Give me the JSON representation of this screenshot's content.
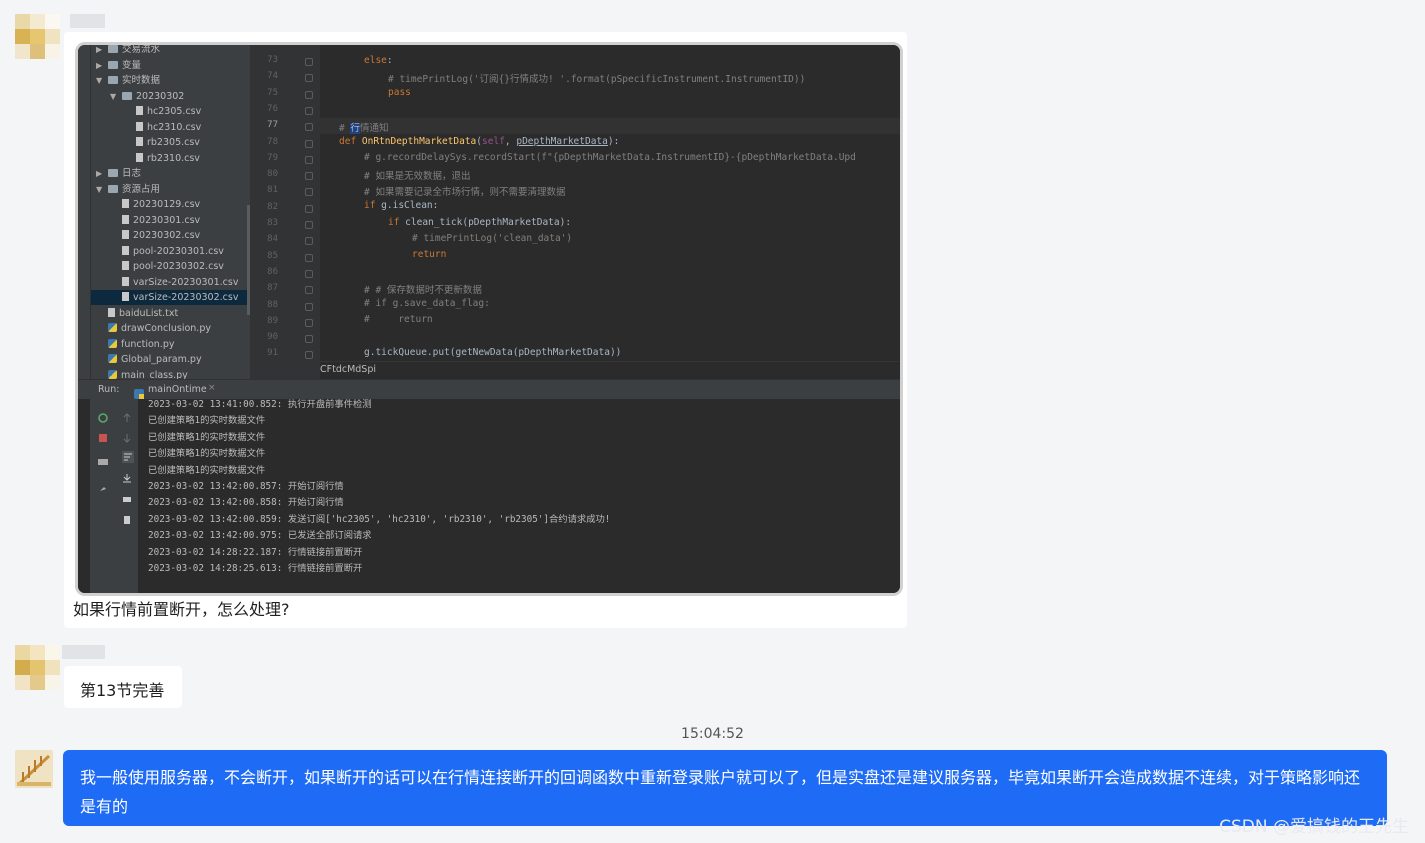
{
  "top_cut_text": "",
  "messages": [
    {
      "sender": "other",
      "caption": "如果行情前置断开，怎么处理?",
      "screenshot": {
        "tree": [
          {
            "label": "交易流水",
            "type": "folder",
            "indent": 1,
            "arrow": "▶"
          },
          {
            "label": "变量",
            "type": "folder",
            "indent": 1,
            "arrow": "▶"
          },
          {
            "label": "实时数据",
            "type": "folder",
            "indent": 1,
            "arrow": "▼"
          },
          {
            "label": "20230302",
            "type": "folder",
            "indent": 2,
            "arrow": "▼"
          },
          {
            "label": "hc2305.csv",
            "type": "file",
            "indent": 3
          },
          {
            "label": "hc2310.csv",
            "type": "file",
            "indent": 3
          },
          {
            "label": "rb2305.csv",
            "type": "file",
            "indent": 3
          },
          {
            "label": "rb2310.csv",
            "type": "file",
            "indent": 3
          },
          {
            "label": "日志",
            "type": "folder",
            "indent": 1,
            "arrow": "▶"
          },
          {
            "label": "资源占用",
            "type": "folder",
            "indent": 1,
            "arrow": "▼"
          },
          {
            "label": "20230129.csv",
            "type": "file",
            "indent": 2
          },
          {
            "label": "20230301.csv",
            "type": "file",
            "indent": 2
          },
          {
            "label": "20230302.csv",
            "type": "file",
            "indent": 2
          },
          {
            "label": "pool-20230301.csv",
            "type": "file",
            "indent": 2
          },
          {
            "label": "pool-20230302.csv",
            "type": "file",
            "indent": 2
          },
          {
            "label": "varSize-20230301.csv",
            "type": "file",
            "indent": 2
          },
          {
            "label": "varSize-20230302.csv",
            "type": "file",
            "indent": 2,
            "selected": true
          },
          {
            "label": "baiduList.txt",
            "type": "file",
            "indent": 1
          },
          {
            "label": "drawConclusion.py",
            "type": "py",
            "indent": 1
          },
          {
            "label": "function.py",
            "type": "py",
            "indent": 1
          },
          {
            "label": "Global_param.py",
            "type": "py",
            "indent": 1
          },
          {
            "label": "main_class.py",
            "type": "py",
            "indent": 1
          }
        ],
        "line_numbers": [
          "73",
          "74",
          "75",
          "76",
          "77",
          "78",
          "79",
          "80",
          "81",
          "82",
          "83",
          "84",
          "85",
          "86",
          "87",
          "88",
          "89",
          "90",
          "91"
        ],
        "breadcrumb": "CFtdcMdSpi",
        "run_label": "Run:",
        "run_tab": "mainOntime",
        "logs": [
          "2023-03-02 13:41:00.852: 执行开盘前事件检测",
          "已创建策略1的实时数据文件",
          "已创建策略1的实时数据文件",
          "已创建策略1的实时数据文件",
          "已创建策略1的实时数据文件",
          "2023-03-02 13:42:00.857: 开始订阅行情",
          "2023-03-02 13:42:00.858: 开始订阅行情",
          "2023-03-02 13:42:00.859: 发送订阅['hc2305', 'hc2310', 'rb2310', 'rb2305']合约请求成功!",
          "2023-03-02 13:42:00.975: 已发送全部订阅请求",
          "2023-03-02 14:28:22.187: 行情链接前置断开",
          "2023-03-02 14:28:25.613: 行情链接前置断开"
        ]
      }
    },
    {
      "sender": "other",
      "text": "第13节完善"
    },
    {
      "sender": "self",
      "timestamp": "15:04:52",
      "text": "我一般使用服务器，不会断开，如果断开的话可以在行情连接断开的回调函数中重新登录账户就可以了，但是实盘还是建议服务器，毕竟如果断开会造成数据不连续，对于策略影响还是有的"
    }
  ],
  "watermark": "CSDN @爱搞钱的王先生",
  "colors": {
    "self_bubble": "#1e6bf5",
    "other_bubble": "#ffffff",
    "background": "#f4f5f7"
  }
}
